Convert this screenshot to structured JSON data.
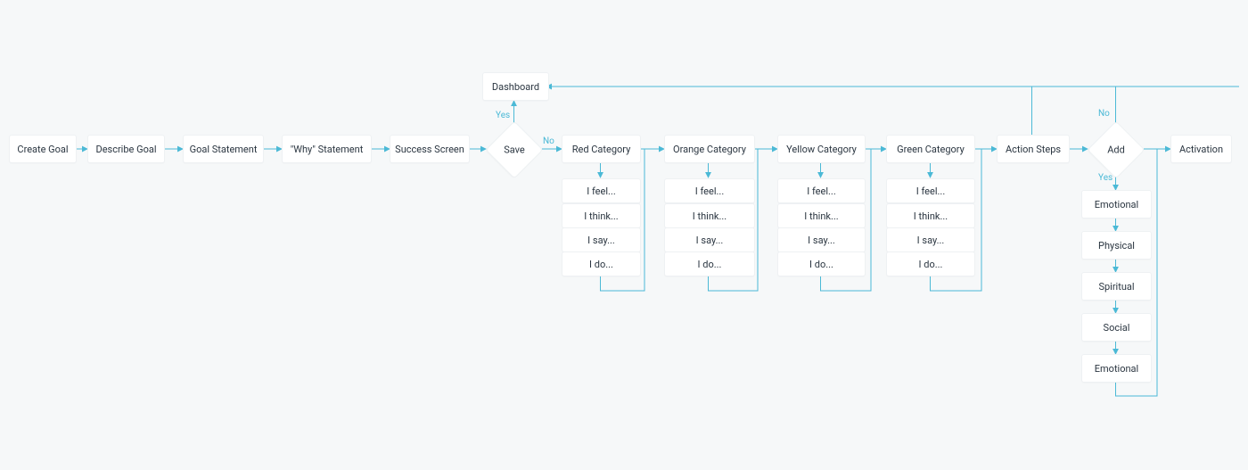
{
  "main": {
    "create": "Create Goal",
    "describe": "Describe Goal",
    "statement": "Goal Statement",
    "why": "\"Why\" Statement",
    "success": "Success Screen",
    "action_steps": "Action Steps",
    "activation": "Activation",
    "dashboard": "Dashboard"
  },
  "decisions": {
    "save": "Save",
    "add": "Add"
  },
  "labels": {
    "yes1": "Yes",
    "no1": "No",
    "yes2": "Yes",
    "no2": "No"
  },
  "categories": {
    "red": {
      "title": "Red Category",
      "feel": "I feel...",
      "think": "I think...",
      "say": "I say...",
      "do": "I do..."
    },
    "orange": {
      "title": "Orange Category",
      "feel": "I feel...",
      "think": "I think...",
      "say": "I say...",
      "do": "I do..."
    },
    "yellow": {
      "title": "Yellow Category",
      "feel": "I feel...",
      "think": "I think...",
      "say": "I say...",
      "do": "I do..."
    },
    "green": {
      "title": "Green Category",
      "feel": "I feel...",
      "think": "I think...",
      "say": "I say...",
      "do": "I do..."
    }
  },
  "steps": {
    "emotional1": "Emotional",
    "physical": "Physical",
    "spiritual": "Spiritual",
    "social": "Social",
    "emotional2": "Emotional"
  }
}
